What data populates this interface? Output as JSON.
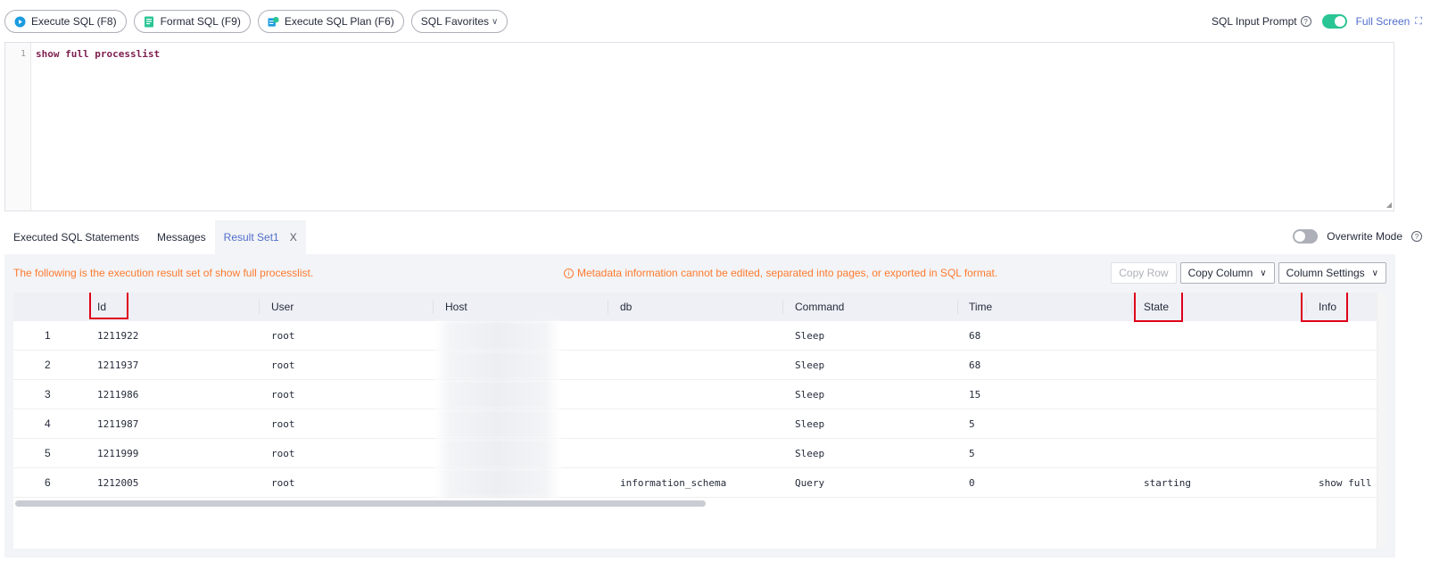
{
  "toolbar": {
    "execute_sql": "Execute SQL (F8)",
    "format_sql": "Format SQL (F9)",
    "execute_plan": "Execute SQL Plan (F6)",
    "favorites": "SQL Favorites",
    "sql_input_prompt": "SQL Input Prompt",
    "sql_input_prompt_enabled": true,
    "full_screen": "Full Screen"
  },
  "editor": {
    "line_number": "1",
    "code": "show full processlist"
  },
  "tabs": [
    {
      "label": "Executed SQL Statements",
      "active": false
    },
    {
      "label": "Messages",
      "active": false
    },
    {
      "label": "Result Set1",
      "active": true,
      "close": "X"
    }
  ],
  "overwrite_mode": {
    "label": "Overwrite Mode",
    "enabled": false
  },
  "result": {
    "info": "The following is the execution result set of show full processlist.",
    "warning": "Metadata information cannot be edited, separated into pages, or exported in SQL format.",
    "buttons": {
      "copy_row": "Copy Row",
      "copy_column": "Copy Column",
      "column_settings": "Column Settings"
    },
    "columns": [
      "",
      "Id",
      "User",
      "Host",
      "db",
      "Command",
      "Time",
      "State",
      "Info"
    ],
    "rows": [
      {
        "n": "1",
        "id": "1211922",
        "user": "root",
        "db": "",
        "command": "Sleep",
        "time": "68",
        "state": "",
        "info": ""
      },
      {
        "n": "2",
        "id": "1211937",
        "user": "root",
        "db": "",
        "command": "Sleep",
        "time": "68",
        "state": "",
        "info": ""
      },
      {
        "n": "3",
        "id": "1211986",
        "user": "root",
        "db": "",
        "command": "Sleep",
        "time": "15",
        "state": "",
        "info": ""
      },
      {
        "n": "4",
        "id": "1211987",
        "user": "root",
        "db": "",
        "command": "Sleep",
        "time": "5",
        "state": "",
        "info": ""
      },
      {
        "n": "5",
        "id": "1211999",
        "user": "root",
        "db": "",
        "command": "Sleep",
        "time": "5",
        "state": "",
        "info": ""
      },
      {
        "n": "6",
        "id": "1212005",
        "user": "root",
        "db": "information_schema",
        "command": "Query",
        "time": "0",
        "state": "starting",
        "info": "show full p"
      }
    ]
  },
  "colors": {
    "accent": "#526ecc",
    "toggle_on": "#2ac594",
    "warning": "#ff7a2e",
    "highlight": "#e0001a"
  }
}
